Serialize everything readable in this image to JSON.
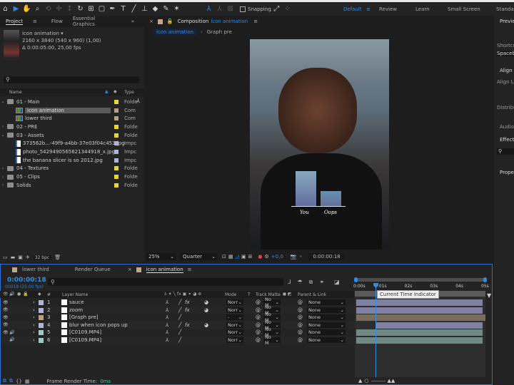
{
  "toolbar": {
    "snapping_label": "Snapping",
    "workspaces": [
      "Default",
      "Review",
      "Learn",
      "Small Screen",
      "Standard"
    ],
    "active_workspace": "Default"
  },
  "project_panel": {
    "tabs": [
      "Project",
      "Flow",
      "Essential Graphics"
    ],
    "active_tab": "Project",
    "comp_name": "icon animation",
    "comp_resolution": "2160 x 3840  (540 x 960) (1,00)",
    "comp_duration": "Δ 0:00:05:00, 25,00 fps",
    "search_placeholder": "",
    "columns": {
      "name": "Name",
      "type": "Type"
    },
    "items": [
      {
        "name": "01 - Main",
        "kind": "folder",
        "expanded": true,
        "indent": 0,
        "label_color": "#e8d33a",
        "type": "Folde"
      },
      {
        "name": "icon animation",
        "kind": "comp",
        "indent": 1,
        "selected": true,
        "label_color": "#b89e82",
        "type": "Com"
      },
      {
        "name": "lower third",
        "kind": "comp",
        "indent": 1,
        "label_color": "#b89e82",
        "type": "Com"
      },
      {
        "name": "02 - PRE",
        "kind": "folder",
        "expanded": false,
        "indent": 0,
        "label_color": "#e8d33a",
        "type": "Folde"
      },
      {
        "name": "03 - Assets",
        "kind": "folder",
        "expanded": true,
        "indent": 0,
        "label_color": "#e8d33a",
        "type": "Folde"
      },
      {
        "name": "373562b...-49f9-a4bb-37e03f04c453.jpg",
        "kind": "file",
        "indent": 1,
        "label_color": "#b3b3d6",
        "type": "Impc"
      },
      {
        "name": "photo_5429490565621344918_x.jpg",
        "kind": "file",
        "indent": 1,
        "label_color": "#b3b3d6",
        "type": "Impc"
      },
      {
        "name": "the banana slicer is so 2012.jpg",
        "kind": "file",
        "indent": 1,
        "label_color": "#b3b3d6",
        "type": "Impc"
      },
      {
        "name": "04 - Textures",
        "kind": "folder",
        "expanded": false,
        "indent": 0,
        "label_color": "#e8d33a",
        "type": "Folde"
      },
      {
        "name": "05 - Clips",
        "kind": "folder",
        "expanded": false,
        "indent": 0,
        "label_color": "#e8d33a",
        "type": "Folde"
      },
      {
        "name": "Solids",
        "kind": "folder",
        "expanded": false,
        "indent": 0,
        "label_color": "#e8d33a",
        "type": "Folde"
      }
    ],
    "bpc": "32 bpc"
  },
  "composition_panel": {
    "tab_label": "Composition",
    "tab_comp": "icon animation",
    "breadcrumbs": [
      "icon animation",
      "Graph pre"
    ],
    "overlay_chart": {
      "labels": [
        "You",
        "Oops"
      ],
      "values": [
        1.0,
        0.43
      ]
    },
    "zoom": "25%",
    "resolution": "Quarter",
    "exposure": "+0,0",
    "timecode": "0:00:00:18"
  },
  "right_panel": {
    "items": [
      "Preview",
      "Shortcut",
      "Spacebar",
      "Align",
      "Align Layers to:",
      "Distribute Layers:",
      "Audio",
      "Effects & Presets",
      "Properties"
    ]
  },
  "timeline": {
    "tabs": [
      "lower third",
      "Render Queue",
      "icon animation"
    ],
    "active_tab": "icon animation",
    "current_time": "0:00:00:18",
    "current_frame": "00018 (25.00 fps)",
    "columns": {
      "num": "#",
      "layer_name": "Layer Name",
      "mode": "Mode",
      "t": "T",
      "track_matte": "Track Matte",
      "parent": "Parent & Link"
    },
    "ruler": [
      "0:00s",
      "01s",
      "02s",
      "03s",
      "04s",
      "05s"
    ],
    "tooltip": "Current Time Indicator",
    "layers": [
      {
        "num": "1",
        "name": "sauce",
        "label_color": "#b3b3d6",
        "mode": "Norr",
        "track_matte": "No M",
        "parent": "None",
        "eye": true,
        "audio": false,
        "track_color": "#8080a0",
        "track_start": 0.0
      },
      {
        "num": "2",
        "name": "zoom",
        "label_color": "#b3b3d6",
        "mode": "Norr",
        "track_matte": "No M",
        "parent": "None",
        "eye": true,
        "audio": false,
        "track_color": "#8080a0",
        "track_start": 0.0
      },
      {
        "num": "3",
        "name": "[Graph pre]",
        "label_color": "#b89e82",
        "mode": "-",
        "track_matte": "No M",
        "parent": "None",
        "eye": true,
        "audio": false,
        "track_color": "#7a6d5c",
        "track_start": 0.0
      },
      {
        "num": "4",
        "name": "blur when icon pops up",
        "label_color": "#b3b3d6",
        "mode": "Norr",
        "track_matte": "No M",
        "parent": "None",
        "eye": true,
        "audio": false,
        "track_color": "#8080a0",
        "track_start": 0.16
      },
      {
        "num": "5",
        "name": "[C0109.MP4]",
        "label_color": "#a3c7c7",
        "mode": "Norr",
        "track_matte": "No M",
        "parent": "None",
        "eye": true,
        "audio": true,
        "track_color": "#6e8a82",
        "track_start": 0.0
      },
      {
        "num": "6",
        "name": "[C0109.MP4]",
        "label_color": "#a3c7c7",
        "mode": "Norr",
        "track_matte": "No M",
        "parent": "None",
        "eye": false,
        "audio": true,
        "track_color": "#6e8a82",
        "track_start": 0.0
      }
    ],
    "frame_render_label": "Frame Render Time:",
    "frame_render_value": "0ms"
  }
}
